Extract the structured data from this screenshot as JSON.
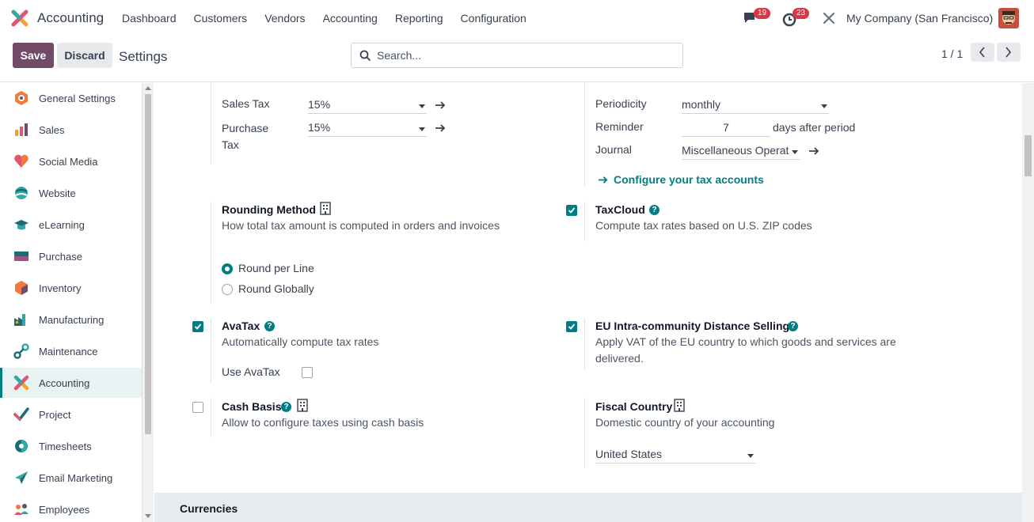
{
  "navbar": {
    "app_name": "Accounting",
    "menu": [
      "Dashboard",
      "Customers",
      "Vendors",
      "Accounting",
      "Reporting",
      "Configuration"
    ],
    "chat_count": "19",
    "activity_count": "23",
    "company": "My Company (San Francisco)"
  },
  "control": {
    "save_label": "Save",
    "discard_label": "Discard",
    "title": "Settings",
    "search_placeholder": "Search...",
    "pager": "1 / 1"
  },
  "sidebar": {
    "items": [
      {
        "label": "General Settings",
        "icon": "general-settings-icon"
      },
      {
        "label": "Sales",
        "icon": "sales-icon"
      },
      {
        "label": "Social Media",
        "icon": "social-media-icon"
      },
      {
        "label": "Website",
        "icon": "website-icon"
      },
      {
        "label": "eLearning",
        "icon": "elearning-icon"
      },
      {
        "label": "Purchase",
        "icon": "purchase-icon"
      },
      {
        "label": "Inventory",
        "icon": "inventory-icon"
      },
      {
        "label": "Manufacturing",
        "icon": "manufacturing-icon"
      },
      {
        "label": "Maintenance",
        "icon": "maintenance-icon"
      },
      {
        "label": "Accounting",
        "icon": "accounting-icon",
        "active": true
      },
      {
        "label": "Project",
        "icon": "project-icon"
      },
      {
        "label": "Timesheets",
        "icon": "timesheets-icon"
      },
      {
        "label": "Email Marketing",
        "icon": "email-marketing-icon"
      },
      {
        "label": "Employees",
        "icon": "employees-icon"
      }
    ]
  },
  "taxes": {
    "sales_tax_label": "Sales Tax",
    "sales_tax_value": "15%",
    "purchase_tax_label": "Purchase Tax",
    "purchase_tax_value": "15%",
    "periodicity_label": "Periodicity",
    "periodicity_value": "monthly",
    "reminder_label": "Reminder",
    "reminder_value": "7",
    "reminder_suffix": "days after period",
    "journal_label": "Journal",
    "journal_value": "Miscellaneous Operat",
    "configure_link": "Configure your tax accounts"
  },
  "rounding": {
    "title": "Rounding Method",
    "desc": "How total tax amount is computed in orders and invoices",
    "options": [
      "Round per Line",
      "Round Globally"
    ],
    "selected": "Round per Line"
  },
  "taxcloud": {
    "title": "TaxCloud",
    "desc": "Compute tax rates based on U.S. ZIP codes",
    "checked": true
  },
  "avatax": {
    "title": "AvaTax",
    "desc": "Automatically compute tax rates",
    "use_label": "Use AvaTax",
    "checked": true
  },
  "eu": {
    "title": "EU Intra-community Distance Selling",
    "desc": "Apply VAT of the EU country to which goods and services are delivered.",
    "checked": true
  },
  "cash_basis": {
    "title": "Cash Basis",
    "desc": "Allow to configure taxes using cash basis",
    "checked": false
  },
  "fiscal": {
    "title": "Fiscal Country",
    "desc": "Domestic country of your accounting",
    "value": "United States"
  },
  "currencies": {
    "title": "Currencies"
  },
  "colors": {
    "primary": "#714b67",
    "accent": "#017e84",
    "badge": "#dc3545"
  }
}
